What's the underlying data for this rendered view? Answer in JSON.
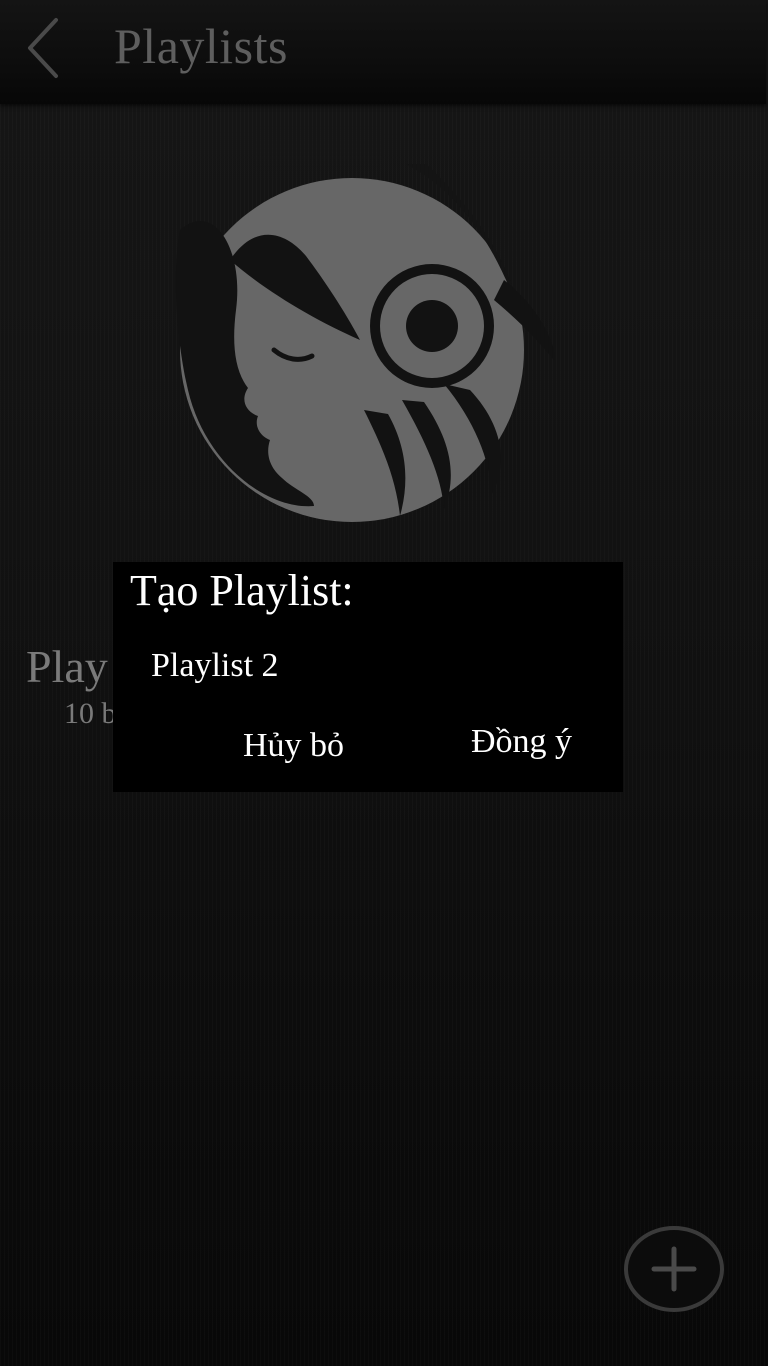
{
  "header": {
    "title": "Playlists",
    "back_icon": "chevron-left-icon"
  },
  "hero": {
    "icon": "headphones-woman-icon",
    "color": "#6a6a6a"
  },
  "list": {
    "items": [
      {
        "title": "Play",
        "subtitle": "10 b"
      }
    ]
  },
  "dialog": {
    "title": "Tạo Playlist:",
    "input_value": "Playlist 2",
    "cancel_label": "Hủy bỏ",
    "ok_label": "Đồng ý"
  },
  "fab": {
    "icon": "plus-circle-icon"
  }
}
